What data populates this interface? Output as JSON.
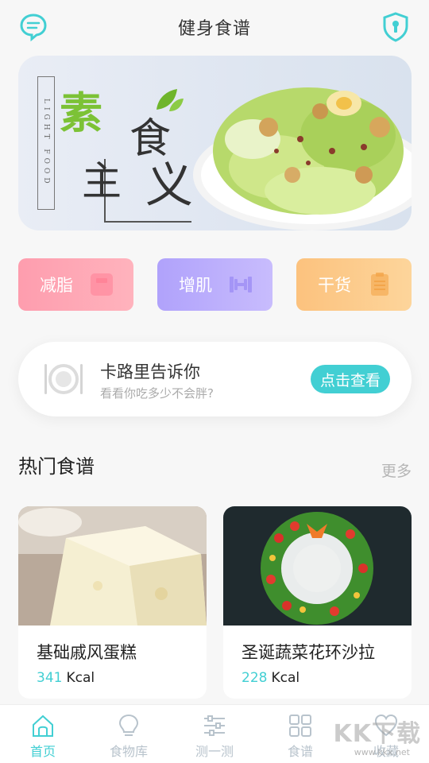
{
  "header": {
    "title": "健身食谱",
    "left_icon": "chat-bubble-icon",
    "right_icon": "shield-keyhole-icon"
  },
  "banner": {
    "vertical_text": "LIGHT FOOD",
    "char1": "素",
    "char2": "食",
    "char3": "主",
    "char4": "义"
  },
  "categories": [
    {
      "label": "减脂",
      "icon": "scale-icon",
      "color": "#fe9dae"
    },
    {
      "label": "增肌",
      "icon": "dumbbell-icon",
      "color": "#b0a2fb"
    },
    {
      "label": "干货",
      "icon": "clipboard-icon",
      "color": "#fcc27e"
    }
  ],
  "calorie_card": {
    "title": "卡路里告诉你",
    "subtitle": "看看你吃多少不会胖?",
    "button": "点击查看",
    "icon": "plate-fork-knife-icon"
  },
  "hot": {
    "title": "热门食谱",
    "more": "更多"
  },
  "recipes": [
    {
      "name": "基础戚风蛋糕",
      "kcal": "341",
      "unit": "Kcal"
    },
    {
      "name": "圣诞蔬菜花环沙拉",
      "kcal": "228",
      "unit": "Kcal"
    }
  ],
  "tabs": [
    {
      "label": "首页",
      "icon": "home-icon",
      "active": true
    },
    {
      "label": "食物库",
      "icon": "lightbulb-icon",
      "active": false
    },
    {
      "label": "测一测",
      "icon": "sliders-icon",
      "active": false
    },
    {
      "label": "食谱",
      "icon": "grid-icon",
      "active": false
    },
    {
      "label": "收藏",
      "icon": "heart-icon",
      "active": false
    }
  ],
  "watermark": {
    "brand": "KK下载",
    "url": "www.kkx.net"
  },
  "colors": {
    "accent": "#42cfd3",
    "background": "#f7f7f7"
  }
}
